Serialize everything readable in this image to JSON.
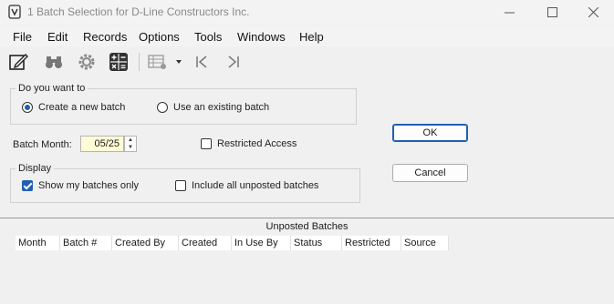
{
  "window": {
    "title": "1 Batch Selection for D-Line Constructors Inc."
  },
  "menu": [
    "File",
    "Edit",
    "Records",
    "Options",
    "Tools",
    "Windows",
    "Help"
  ],
  "toolbar_icons": [
    "edit-icon",
    "binoculars-icon",
    "settings-gear-icon",
    "calculator-icon",
    "grid-options-icon",
    "dropdown-arrow-icon",
    "first-record-icon",
    "last-record-icon"
  ],
  "batch_choice": {
    "legend": "Do you want to",
    "option_new": "Create a new batch",
    "option_existing": "Use an existing batch",
    "selected": "Create a new batch"
  },
  "batch_month": {
    "label": "Batch Month:",
    "value": "05/25"
  },
  "restricted_access": {
    "label": "Restricted Access",
    "checked": false
  },
  "display": {
    "legend": "Display",
    "my_batches_label": "Show my batches only",
    "my_batches_checked": true,
    "include_unposted_label": "Include all unposted batches",
    "include_unposted_checked": false
  },
  "buttons": {
    "ok": "OK",
    "cancel": "Cancel"
  },
  "grid": {
    "title": "Unposted Batches",
    "columns": [
      "Month",
      "Batch #",
      "Created By",
      "Created",
      "In Use By",
      "Status",
      "Restricted",
      "Source"
    ],
    "rows": []
  },
  "colors": {
    "accent": "#1e5fb4",
    "input_bg": "#fffbd6"
  }
}
